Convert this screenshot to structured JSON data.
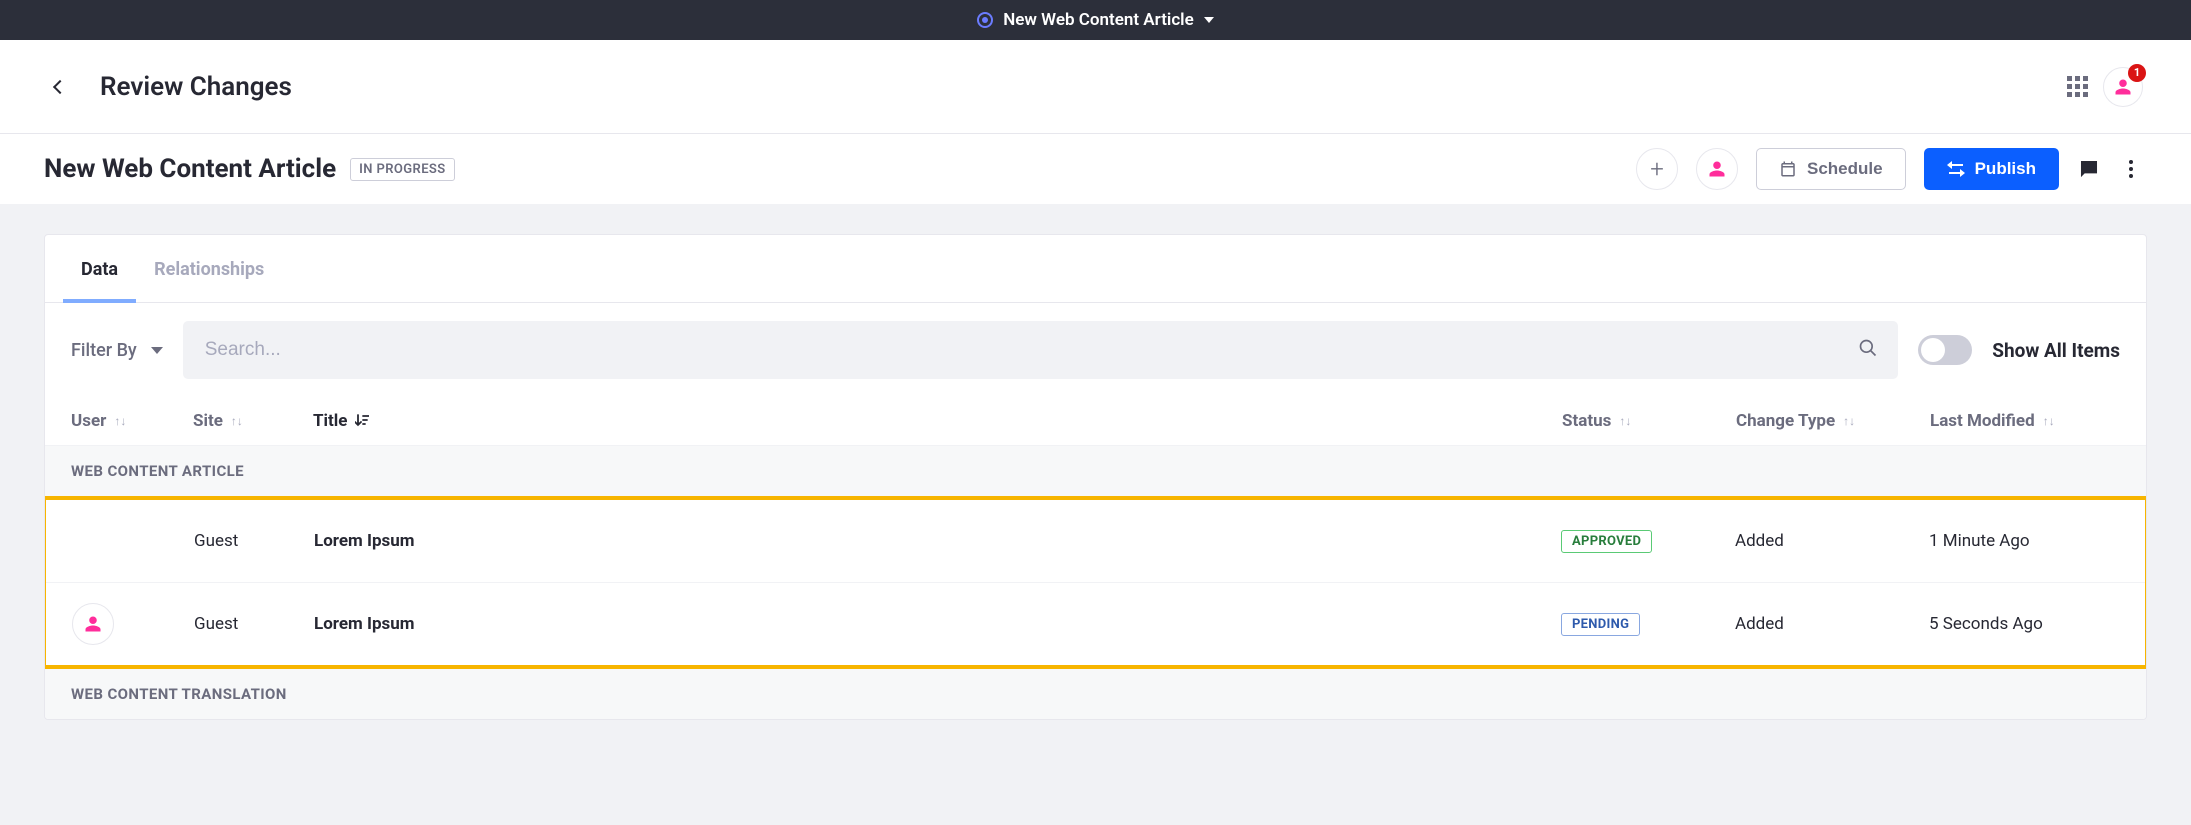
{
  "topbar": {
    "title": "New Web Content Article"
  },
  "header": {
    "title": "Review Changes",
    "notification_count": "1"
  },
  "subheader": {
    "article_title": "New Web Content Article",
    "status": "IN PROGRESS",
    "schedule_label": "Schedule",
    "publish_label": "Publish"
  },
  "tabs": {
    "data": "Data",
    "relationships": "Relationships"
  },
  "toolbar": {
    "filter_by": "Filter By",
    "search_placeholder": "Search...",
    "show_all": "Show All Items"
  },
  "columns": {
    "user": "User",
    "site": "Site",
    "title": "Title",
    "status": "Status",
    "change_type": "Change Type",
    "last_modified": "Last Modified"
  },
  "groups": {
    "g1": {
      "header": "WEB CONTENT ARTICLE"
    },
    "g2": {
      "header": "WEB CONTENT TRANSLATION"
    }
  },
  "rows": {
    "r1": {
      "has_avatar": false,
      "site": "Guest",
      "title": "Lorem Ipsum",
      "status_text": "APPROVED",
      "status_class": "approved",
      "change_type": "Added",
      "last_modified": "1 Minute Ago"
    },
    "r2": {
      "has_avatar": true,
      "site": "Guest",
      "title": "Lorem Ipsum",
      "status_text": "PENDING",
      "status_class": "pending",
      "change_type": "Added",
      "last_modified": "5 Seconds Ago"
    }
  },
  "colors": {
    "primary": "#0b5fff",
    "pink": "#ff4fc",
    "highlight": "#f7b500"
  }
}
